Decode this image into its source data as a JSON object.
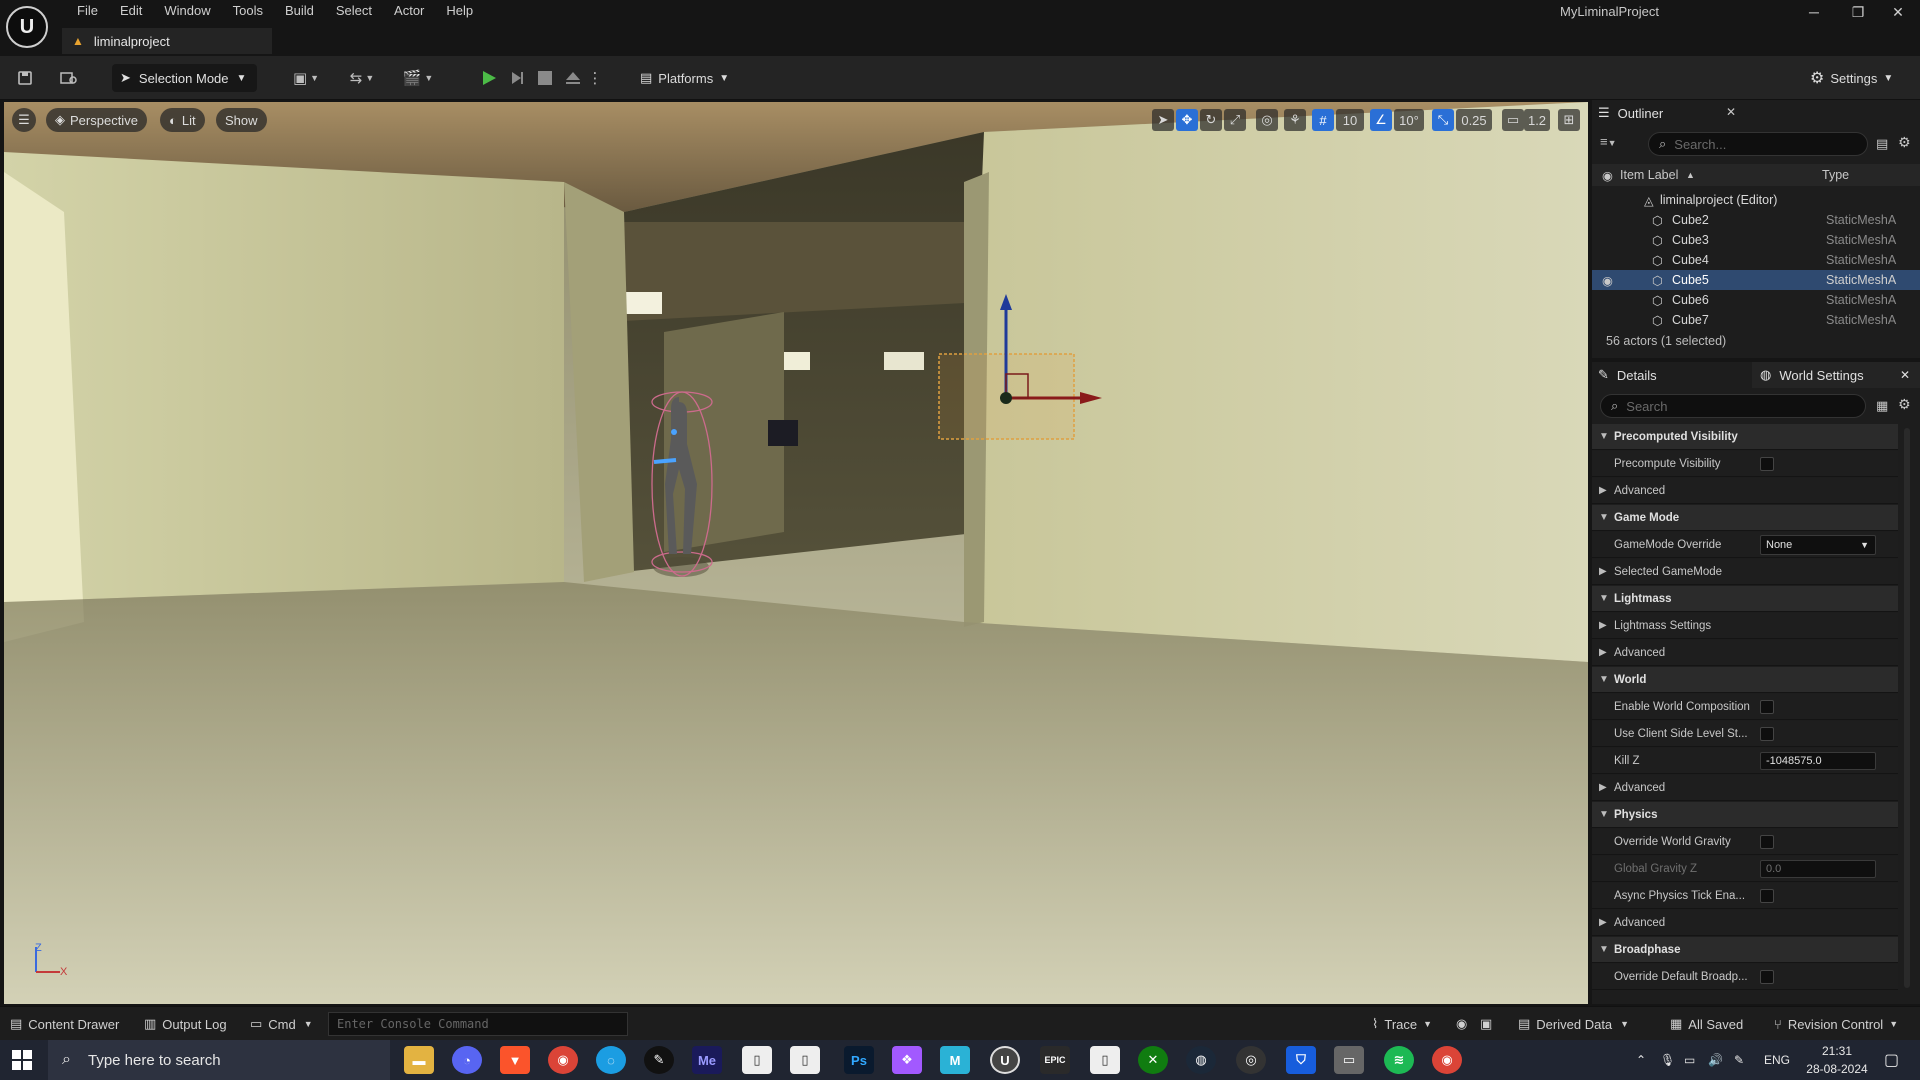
{
  "app": {
    "menu": [
      "File",
      "Edit",
      "Window",
      "Tools",
      "Build",
      "Select",
      "Actor",
      "Help"
    ],
    "tab_label": "liminalproject",
    "project_name": "MyLiminalProject"
  },
  "toolbar": {
    "selection_mode": "Selection Mode",
    "platforms": "Platforms",
    "settings": "Settings"
  },
  "viewport": {
    "perspective": "Perspective",
    "lit": "Lit",
    "show": "Show",
    "grid_snap": "10",
    "rotation_snap": "10°",
    "scale_snap": "0.25",
    "camera_speed": "1.2",
    "axis_z": "Z",
    "axis_x": "X"
  },
  "outliner": {
    "title": "Outliner",
    "search_placeholder": "Search...",
    "col_label": "Item Label",
    "col_type": "Type",
    "root": "liminalproject (Editor)",
    "items": [
      {
        "label": "Cube2",
        "type": "StaticMeshA"
      },
      {
        "label": "Cube3",
        "type": "StaticMeshA"
      },
      {
        "label": "Cube4",
        "type": "StaticMeshA"
      },
      {
        "label": "Cube5",
        "type": "StaticMeshA"
      },
      {
        "label": "Cube6",
        "type": "StaticMeshA"
      },
      {
        "label": "Cube7",
        "type": "StaticMeshA"
      }
    ],
    "footer": "56 actors (1 selected)"
  },
  "details": {
    "tab_details": "Details",
    "tab_world": "World Settings",
    "search_placeholder": "Search",
    "rows": {
      "precomputed_visibility": "Precomputed Visibility",
      "precompute_visibility": "Precompute Visibility",
      "advanced": "Advanced",
      "game_mode": "Game Mode",
      "gamemode_override": "GameMode Override",
      "gamemode_value": "None",
      "selected_gamemode": "Selected GameMode",
      "lightmass": "Lightmass",
      "lightmass_settings": "Lightmass Settings",
      "world": "World",
      "enable_world_composition": "Enable World Composition",
      "use_client_side": "Use Client Side Level St...",
      "kill_z": "Kill Z",
      "kill_z_value": "-1048575.0",
      "physics": "Physics",
      "override_world_gravity": "Override World Gravity",
      "global_gravity_z": "Global Gravity Z",
      "global_gravity_value": "0.0",
      "async_physics": "Async Physics Tick Ena...",
      "broadphase": "Broadphase",
      "override_default_broadp": "Override Default Broadp..."
    }
  },
  "statusbar": {
    "content_drawer": "Content Drawer",
    "output_log": "Output Log",
    "cmd": "Cmd",
    "console_placeholder": "Enter Console Command",
    "trace": "Trace",
    "derived_data": "Derived Data",
    "all_saved": "All Saved",
    "revision_control": "Revision Control"
  },
  "taskbar": {
    "search_placeholder": "Type here to search",
    "lang": "ENG",
    "time": "21:31",
    "date": "28-08-2024"
  },
  "colors": {
    "accent": "#2a6fd6",
    "selection_row": "#2f4a70",
    "play_green": "#4cbb47",
    "warning": "#e8a32f"
  }
}
